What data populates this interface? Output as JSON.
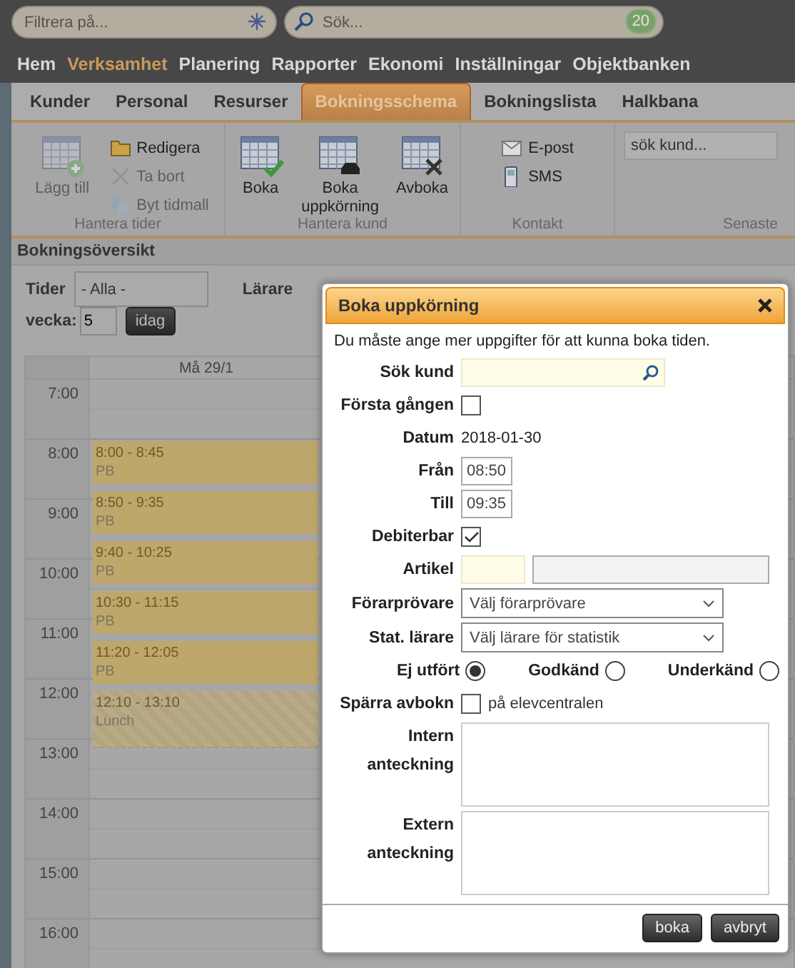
{
  "top_bar": {
    "filter_field": {
      "placeholder": "Filtrera på..."
    },
    "search_field": {
      "placeholder": "Sök...",
      "badge": "20"
    }
  },
  "main_menu": [
    {
      "label": "Hem",
      "selected": false
    },
    {
      "label": "Verksamhet",
      "selected": true
    },
    {
      "label": "Planering",
      "selected": false
    },
    {
      "label": "Rapporter",
      "selected": false
    },
    {
      "label": "Ekonomi",
      "selected": false
    },
    {
      "label": "Inställningar",
      "selected": false
    },
    {
      "label": "Objektbanken",
      "selected": false
    }
  ],
  "tabs": [
    {
      "label": "Kunder",
      "selected": false
    },
    {
      "label": "Personal",
      "selected": false
    },
    {
      "label": "Resurser",
      "selected": false
    },
    {
      "label": "Bokningsschema",
      "selected": true
    },
    {
      "label": "Bokningslista",
      "selected": false
    },
    {
      "label": "Halkbana",
      "selected": false
    }
  ],
  "ribbon": {
    "groups": [
      {
        "kind": "buttons",
        "title": "Hantera tider",
        "items": [
          {
            "label": "Lägg till",
            "kind": "large",
            "disabled": true
          },
          {
            "label": "Redigera",
            "kind": "small",
            "disabled": false
          },
          {
            "label": "Ta bort",
            "kind": "small",
            "disabled": true
          },
          {
            "label": "Byt tidmall",
            "kind": "small",
            "disabled": true
          }
        ]
      },
      {
        "kind": "buttons",
        "title": "Hantera kund",
        "items": [
          {
            "label": "Boka",
            "kind": "large",
            "disabled": false
          },
          {
            "label": "Boka uppkörning",
            "kind": "large",
            "disabled": false
          },
          {
            "label": "Avboka",
            "kind": "large",
            "disabled": false
          }
        ]
      },
      {
        "kind": "buttons",
        "title": "Kontakt",
        "items": [
          {
            "label": "E-post",
            "kind": "small",
            "disabled": false
          },
          {
            "label": "SMS",
            "kind": "small",
            "disabled": false
          }
        ]
      },
      {
        "kind": "search",
        "title": "Senaste",
        "placeholder": "sök kund..."
      }
    ]
  },
  "overview": {
    "title": "Bokningsöversikt",
    "times_label": "Tider",
    "times_value": "- Alla -",
    "teacher_label": "Lärare",
    "week_label": "vecka:",
    "week_value": "5",
    "today_button": "idag"
  },
  "calendar": {
    "day_header": "Må 29/1",
    "hours": [
      "7:00",
      "8:00",
      "9:00",
      "10:00",
      "11:00",
      "12:00",
      "13:00",
      "14:00",
      "15:00",
      "16:00"
    ],
    "events": [
      {
        "time": "8:00 - 8:45",
        "label": "PB",
        "kind": "booking"
      },
      {
        "time": "8:50 - 9:35",
        "label": "PB",
        "kind": "booking"
      },
      {
        "time": "9:40 - 10:25",
        "label": "PB",
        "kind": "booking"
      },
      {
        "time": "10:30 - 11:15",
        "label": "PB",
        "kind": "booking"
      },
      {
        "time": "11:20 - 12:05",
        "label": "PB",
        "kind": "booking"
      },
      {
        "time": "12:10 - 13:10",
        "label": "Lunch",
        "kind": "break"
      }
    ]
  },
  "dialog": {
    "title": "Boka uppkörning",
    "intro": "Du måste ange mer uppgifter för att kunna boka tiden.",
    "fields": [
      {
        "kind": "search",
        "label": "Sök kund"
      },
      {
        "kind": "checkbox",
        "label": "Första gången",
        "checked": false
      },
      {
        "kind": "text",
        "label": "Datum",
        "value": "2018-01-30"
      },
      {
        "kind": "time",
        "label": "Från",
        "value": "08:50"
      },
      {
        "kind": "time",
        "label": "Till",
        "value": "09:35"
      },
      {
        "kind": "checkbox",
        "label": "Debiterbar",
        "checked": true
      },
      {
        "kind": "article",
        "label": "Artikel"
      },
      {
        "kind": "select",
        "label": "Förarprövare",
        "value": "Välj förarprövare"
      },
      {
        "kind": "select",
        "label": "Stat. lärare",
        "value": "Välj lärare för statistik"
      },
      {
        "kind": "radio",
        "options": [
          {
            "label": "Ej utfört",
            "selected": true
          },
          {
            "label": "Godkänd",
            "selected": false
          },
          {
            "label": "Underkänd",
            "selected": false
          }
        ]
      },
      {
        "kind": "checkbox",
        "label": "Spärra avbokn",
        "checked": false,
        "suffix": "på elevcentralen"
      },
      {
        "kind": "textarea",
        "label": "Intern anteckning"
      },
      {
        "kind": "textarea",
        "label": "Extern anteckning"
      }
    ],
    "buttons": [
      "boka",
      "avbryt"
    ]
  }
}
